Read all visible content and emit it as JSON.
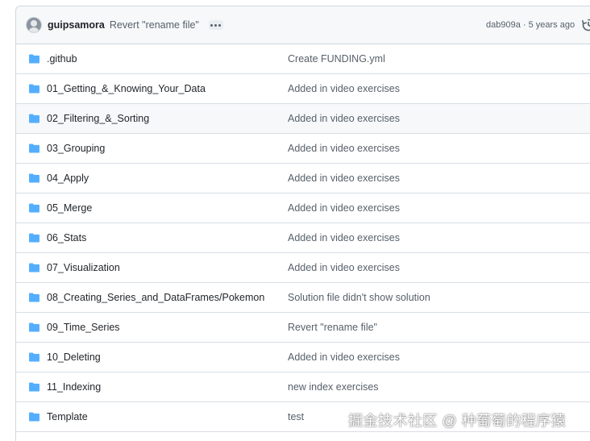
{
  "commit": {
    "author": "guipsamora",
    "message": "Revert \"rename file\"",
    "hash": "dab909a",
    "separator": "·",
    "age": "5 years ago",
    "meta": "dab909a · 5 years ago"
  },
  "entries": [
    {
      "name": ".github",
      "message": "Create FUNDING.yml",
      "icon": "folder-icon"
    },
    {
      "name": "01_Getting_&_Knowing_Your_Data",
      "message": "Added in video exercises",
      "icon": "folder-icon"
    },
    {
      "name": "02_Filtering_&_Sorting",
      "message": "Added in video exercises",
      "icon": "folder-icon"
    },
    {
      "name": "03_Grouping",
      "message": "Added in video exercises",
      "icon": "folder-icon"
    },
    {
      "name": "04_Apply",
      "message": "Added in video exercises",
      "icon": "folder-icon"
    },
    {
      "name": "05_Merge",
      "message": "Added in video exercises",
      "icon": "folder-icon"
    },
    {
      "name": "06_Stats",
      "message": "Added in video exercises",
      "icon": "folder-icon"
    },
    {
      "name": "07_Visualization",
      "message": "Added in video exercises",
      "icon": "folder-icon"
    },
    {
      "name": "08_Creating_Series_and_DataFrames/Pokemon",
      "message": "Solution file didn't show solution",
      "icon": "folder-icon"
    },
    {
      "name": "09_Time_Series",
      "message": "Revert \"rename file\"",
      "icon": "folder-icon"
    },
    {
      "name": "10_Deleting",
      "message": "Added in video exercises",
      "icon": "folder-icon"
    },
    {
      "name": "11_Indexing",
      "message": "new index exercises",
      "icon": "folder-icon"
    },
    {
      "name": "Template",
      "message": "test",
      "icon": "folder-icon"
    }
  ],
  "watermark": "掘金技术社区 @ 种葡萄的程序猿",
  "colors": {
    "folder": "#54aeff",
    "border": "#d0d7de",
    "header_bg": "#f6f8fa",
    "muted_text": "#57606a"
  }
}
